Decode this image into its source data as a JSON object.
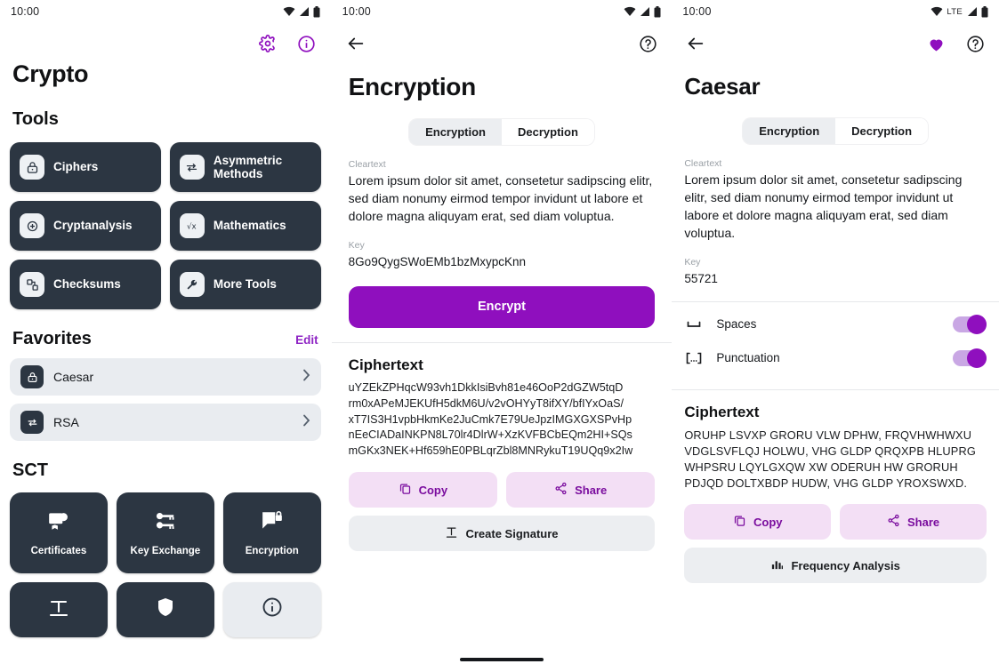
{
  "colors": {
    "accent_purple": "#8f0fbe",
    "dark_card": "#2c3642",
    "tonal_button_bg": "#f3dff5",
    "tonal_button_fg": "#7a0c9e",
    "grey_button_bg": "#eceef1",
    "favorite_row_bg": "#e9ecf0"
  },
  "screen1": {
    "statusbar": {
      "clock": "10:00",
      "icons": [
        "wifi-icon",
        "signal-icon",
        "battery-icon"
      ]
    },
    "appbar": {
      "title": "Crypto",
      "actions": [
        {
          "name": "settings-icon",
          "label": "Settings"
        },
        {
          "name": "info-icon",
          "label": "About"
        }
      ]
    },
    "tools": {
      "heading": "Tools",
      "items": [
        {
          "label": "Ciphers",
          "icon": "lock-icon"
        },
        {
          "label": "Asymmetric Methods",
          "icon": "swap-arrows-icon"
        },
        {
          "label": "Cryptanalysis",
          "icon": "target-plus-icon"
        },
        {
          "label": "Mathematics",
          "icon": "square-root-icon"
        },
        {
          "label": "Checksums",
          "icon": "blocks-icon"
        },
        {
          "label": "More Tools",
          "icon": "wrench-icon"
        }
      ]
    },
    "favorites": {
      "heading": "Favorites",
      "edit_label": "Edit",
      "items": [
        {
          "label": "Caesar",
          "icon": "lock-icon",
          "chevron": "chevron-right-icon"
        },
        {
          "label": "RSA",
          "icon": "swap-arrows-icon",
          "chevron": "chevron-right-icon"
        }
      ]
    },
    "sct": {
      "heading": "SCT",
      "items": [
        {
          "label": "Certificates",
          "icon": "certificate-icon"
        },
        {
          "label": "Key Exchange",
          "icon": "keys-icon"
        },
        {
          "label": "Encryption",
          "icon": "message-lock-icon"
        }
      ],
      "partial_items": [
        {
          "label": "",
          "icon": "signature-icon"
        },
        {
          "label": "",
          "icon": "camera-shield-icon"
        },
        {
          "label": "",
          "icon": "info-circle-icon"
        }
      ]
    }
  },
  "screen2": {
    "statusbar": {
      "clock": "10:00",
      "icons": [
        "wifi-icon",
        "signal-icon",
        "battery-icon"
      ]
    },
    "appbar": {
      "back": "back-arrow-icon",
      "help": "help-circle-icon"
    },
    "title": "Encryption",
    "tabs": [
      {
        "label": "Encryption",
        "active": true
      },
      {
        "label": "Decryption",
        "active": false
      }
    ],
    "cleartext": {
      "label": "Cleartext",
      "value": "Lorem ipsum dolor sit amet, consetetur sadipscing elitr, sed diam nonumy eirmod tempor invidunt ut labore et dolore magna aliquyam erat, sed diam voluptua."
    },
    "key": {
      "label": "Key",
      "value": "8Go9QygSWoEMb1bzMxypcKnn"
    },
    "primary_button": "Encrypt",
    "ciphertext": {
      "heading": "Ciphertext",
      "value": "uYZEkZPHqcW93vh1DkkIsiBvh81e46OoP2dGZW5tqD\nrm0xAPeMJEKUfH5dkM6U/v2vOHYyT8ifXY/bfIYxOaS/\nxT7IS3H1vpbHkmKe2JuCmk7E79UeJpzIMGXGXSPvHp\nnEeCIADaINKPN8L70lr4DlrW+XzKVFBCbEQm2HI+SQs\nmGKx3NEK+Hf659hE0PBLqrZbl8MNRykuT19UQq9x2Iw"
    },
    "actions": [
      {
        "label": "Copy",
        "icon": "copy-icon",
        "style": "tonal"
      },
      {
        "label": "Share",
        "icon": "share-icon",
        "style": "tonal"
      },
      {
        "label": "Create Signature",
        "icon": "signature-icon",
        "style": "grey"
      }
    ]
  },
  "screen3": {
    "statusbar": {
      "clock": "10:00",
      "network": "LTE",
      "icons": [
        "wifi-icon",
        "signal-icon",
        "battery-icon"
      ]
    },
    "appbar": {
      "back": "back-arrow-icon",
      "favorite": "heart-filled-icon",
      "help": "help-circle-icon"
    },
    "title": "Caesar",
    "tabs": [
      {
        "label": "Encryption",
        "active": true
      },
      {
        "label": "Decryption",
        "active": false
      }
    ],
    "cleartext": {
      "label": "Cleartext",
      "value": "Lorem ipsum dolor sit amet, consetetur sadipscing elitr, sed diam nonumy eirmod tempor invidunt ut labore et dolore magna aliquyam erat, sed diam voluptua."
    },
    "key": {
      "label": "Key",
      "value": "55721"
    },
    "options": [
      {
        "label": "Spaces",
        "icon": "space-bar-icon",
        "enabled": true
      },
      {
        "label": "Punctuation",
        "icon": "brackets-icon",
        "enabled": true
      }
    ],
    "ciphertext": {
      "heading": "Ciphertext",
      "value": "ORUHP LSVXP GRORU VLW DPHW, FRQVHWHWXU\nVDGLSVFLQJ HOLWU, VHG GLDP QRQXPB HLUPRG\nWHPSRU LQYLGXQW XW ODERUH HW GRORUH\nPDJQD DOLTXBDP HUDW, VHG GLDP YROXSWXD."
    },
    "actions": [
      {
        "label": "Copy",
        "icon": "copy-icon",
        "style": "tonal"
      },
      {
        "label": "Share",
        "icon": "share-icon",
        "style": "tonal"
      },
      {
        "label": "Frequency Analysis",
        "icon": "bar-chart-icon",
        "style": "grey"
      }
    ]
  }
}
